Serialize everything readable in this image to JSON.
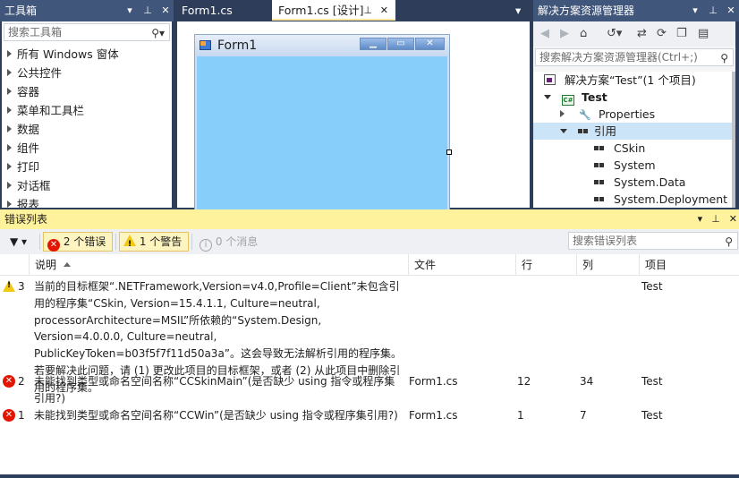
{
  "toolbox": {
    "title": "工具箱",
    "search_placeholder": "搜索工具箱",
    "items": [
      "所有 Windows 窗体",
      "公共控件",
      "容器",
      "菜单和工具栏",
      "数据",
      "组件",
      "打印",
      "对话框",
      "报表"
    ]
  },
  "designer": {
    "tabs": [
      {
        "label": "Form1.cs"
      },
      {
        "label": "Form1.cs [设计]"
      }
    ],
    "form_title": "Form1",
    "form_back_color": "#87cefa"
  },
  "solution_explorer": {
    "title": "解决方案资源管理器",
    "search_placeholder": "搜索解决方案资源管理器(Ctrl+;)",
    "solution_label": "解决方案“Test”(1 个项目)",
    "project": "Test",
    "properties": "Properties",
    "references": "引用",
    "refs": [
      "CSkin",
      "System",
      "System.Data",
      "System.Deployment"
    ]
  },
  "error_list": {
    "title": "错误列表",
    "errors_btn": "2 个错误",
    "warnings_btn": "1 个警告",
    "messages_btn": "0 个消息",
    "search_placeholder": "搜索错误列表",
    "columns": {
      "desc": "说明",
      "file": "文件",
      "line": "行",
      "col": "列",
      "project": "项目"
    },
    "rows": [
      {
        "kind": "warning",
        "num": "3",
        "desc": "当前的目标框架“.NETFramework,Version=v4.0,Profile=Client”未包含引用的程序集“CSkin, Version=15.4.1.1, Culture=neutral, processorArchitecture=MSIL”所依赖的“System.Design, Version=4.0.0.0, Culture=neutral, PublicKeyToken=b03f5f7f11d50a3a”。这会导致无法解析引用的程序集。若要解决此问题，请 (1) 更改此项目的目标框架，或者 (2) 从此项目中删除引用的程序集。",
        "file": "",
        "line": "",
        "col": "",
        "project": "Test"
      },
      {
        "kind": "error",
        "num": "2",
        "desc": "未能找到类型或命名空间名称“CCSkinMain”(是否缺少 using 指令或程序集引用?)",
        "file": "Form1.cs",
        "line": "12",
        "col": "34",
        "project": "Test"
      },
      {
        "kind": "error",
        "num": "1",
        "desc": "未能找到类型或命名空间名称“CCWin”(是否缺少 using 指令或程序集引用?)",
        "file": "Form1.cs",
        "line": "1",
        "col": "7",
        "project": "Test"
      }
    ]
  },
  "colors": {
    "chrome": "#2d3d5a",
    "active_title": "#fff29d",
    "selection": "#cce4f7"
  }
}
